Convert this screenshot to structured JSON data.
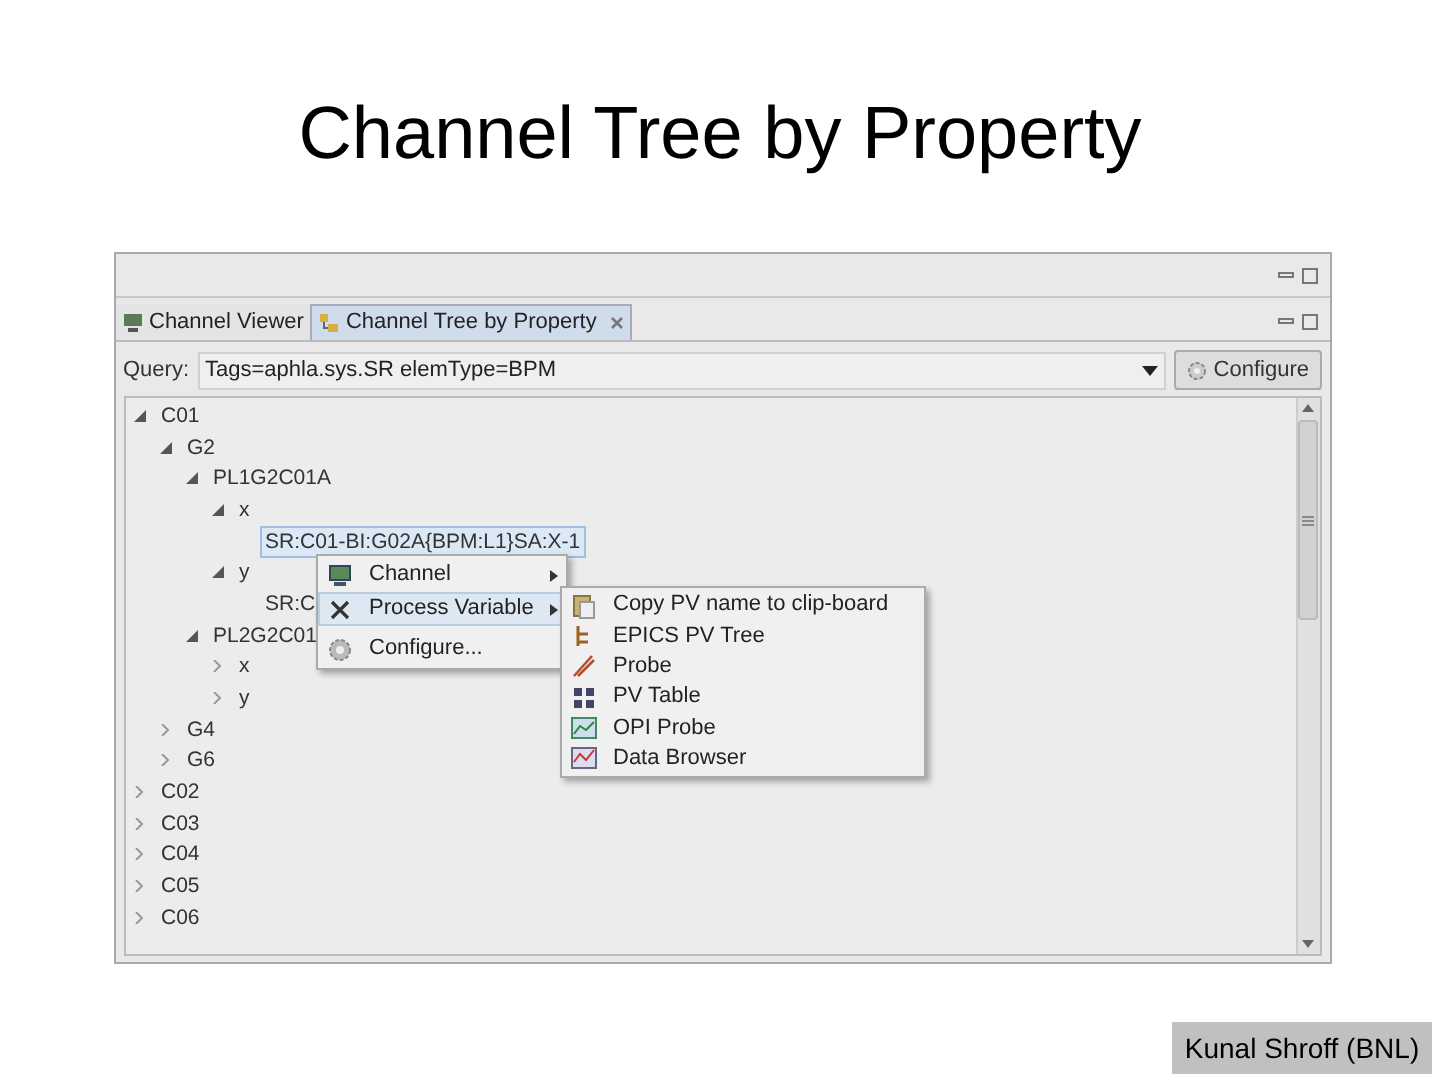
{
  "slide": {
    "title": "Channel Tree by Property",
    "footer": "Kunal Shroff (BNL)"
  },
  "tabs": [
    {
      "label": "Channel Viewer",
      "selected": false,
      "closable": false
    },
    {
      "label": "Channel Tree by Property",
      "selected": true,
      "closable": true
    }
  ],
  "query": {
    "label": "Query:",
    "value": "Tags=aphla.sys.SR elemType=BPM",
    "button": "Configure"
  },
  "tree": [
    {
      "label": "C01",
      "expanded": true,
      "children": [
        {
          "label": "G2",
          "expanded": true,
          "children": [
            {
              "label": "PL1G2C01A",
              "expanded": true,
              "children": [
                {
                  "label": "x",
                  "expanded": true,
                  "children": [
                    {
                      "label": "SR:C01-BI:G02A{BPM:L1}SA:X-1",
                      "selected": true
                    }
                  ]
                },
                {
                  "label": "y",
                  "expanded": true,
                  "children": [
                    {
                      "label": "SR:C",
                      "selected": false
                    }
                  ]
                }
              ]
            },
            {
              "label": "PL2G2C01",
              "expanded": true,
              "children": [
                {
                  "label": "x",
                  "expanded": false
                },
                {
                  "label": "y",
                  "expanded": false
                }
              ]
            }
          ]
        },
        {
          "label": "G4",
          "expanded": false
        },
        {
          "label": "G6",
          "expanded": false
        }
      ]
    },
    {
      "label": "C02",
      "expanded": false
    },
    {
      "label": "C03",
      "expanded": false
    },
    {
      "label": "C04",
      "expanded": false
    },
    {
      "label": "C05",
      "expanded": false
    },
    {
      "label": "C06",
      "expanded": false
    }
  ],
  "context_menu": [
    {
      "label": "Channel",
      "submenu": true,
      "selected": false,
      "kind": "monitor"
    },
    {
      "label": "Process Variable",
      "submenu": true,
      "selected": true,
      "kind": "variable"
    },
    {
      "label": "Configure...",
      "submenu": false,
      "selected": false,
      "kind": "gear"
    }
  ],
  "submenu": [
    {
      "label": "Copy PV name to clip-board",
      "kind": "clipboard"
    },
    {
      "label": "EPICS PV Tree",
      "kind": "tree"
    },
    {
      "label": "Probe",
      "kind": "probe"
    },
    {
      "label": "PV Table",
      "kind": "table"
    },
    {
      "label": "OPI Probe",
      "kind": "opi"
    },
    {
      "label": "Data Browser",
      "kind": "chart"
    }
  ]
}
